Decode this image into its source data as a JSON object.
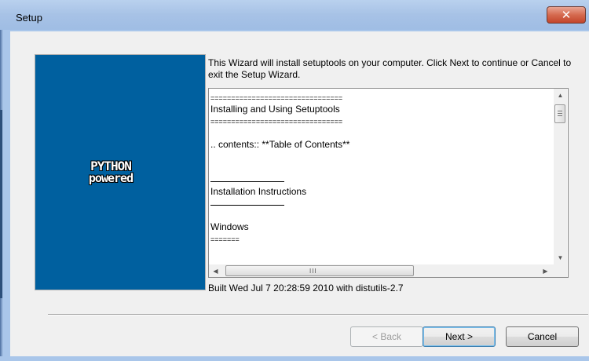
{
  "window": {
    "title": "Setup",
    "close_glyph": "✕"
  },
  "banner": {
    "logo_line1": "PYTHON",
    "logo_line2": "powered",
    "background": "#00609f"
  },
  "intro_text": "This Wizard will install setuptools on your computer. Click Next to continue or Cancel to exit the Setup Wizard.",
  "readme": {
    "separator_1": "================================",
    "heading": "Installing and Using Setuptools",
    "separator_2": "================================",
    "contents_directive": ".. contents:: **Table of Contents**",
    "section_1": "Installation Instructions",
    "section_2": "Windows",
    "section_2_underline": "======="
  },
  "scrollbar": {
    "up_icon": "▲",
    "down_icon": "▼",
    "left_icon": "◀",
    "right_icon": "▶",
    "grip": "III"
  },
  "build_info": "Built Wed Jul  7 20:28:59 2010 with distutils-2.7",
  "buttons": {
    "back": "< Back",
    "next": "Next >",
    "cancel": "Cancel"
  }
}
